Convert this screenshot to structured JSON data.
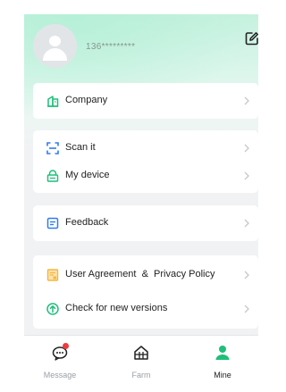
{
  "colors": {
    "accent": "#1fbf7a",
    "blue": "#2f7bf5",
    "yellow": "#f5b73b",
    "badge": "#ee3b3b",
    "chevron": "#c8c8c8"
  },
  "profile": {
    "avatar_icon": "user-avatar-icon",
    "phone": "136*********",
    "edit_icon": "edit-icon"
  },
  "menu": {
    "company": {
      "label": "Company",
      "icon": "company-icon"
    },
    "scan": {
      "label": "Scan it",
      "icon": "scan-icon"
    },
    "device": {
      "label": "My device",
      "icon": "device-icon"
    },
    "feedback": {
      "label": "Feedback",
      "icon": "feedback-icon"
    },
    "agreement": {
      "label": "User Agreement  &  Privacy Policy",
      "icon": "document-icon"
    },
    "update": {
      "label": "Check for new versions",
      "icon": "upload-icon"
    }
  },
  "tabs": [
    {
      "label": "Message",
      "icon": "message-icon",
      "badge": true,
      "active": false
    },
    {
      "label": "Farm",
      "icon": "farm-icon",
      "badge": false,
      "active": false
    },
    {
      "label": "Mine",
      "icon": "user-icon",
      "badge": false,
      "active": true
    }
  ]
}
